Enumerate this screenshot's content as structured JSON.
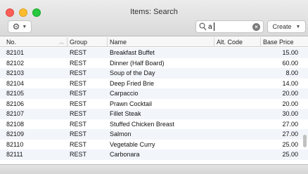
{
  "window": {
    "title": "Items: Search"
  },
  "toolbar": {
    "gear_icon": "gear-icon",
    "search_value": "a",
    "create_label": "Create"
  },
  "columns": {
    "no": "No.",
    "group": "Group",
    "name": "Name",
    "alt_code": "Alt. Code",
    "base_price": "Base Price"
  },
  "rows": [
    {
      "no": "82101",
      "group": "REST",
      "name": "Breakfast Buffet",
      "alt_code": "",
      "price": "15.00"
    },
    {
      "no": "82102",
      "group": "REST",
      "name": "Dinner (Half Board)",
      "alt_code": "",
      "price": "60.00"
    },
    {
      "no": "82103",
      "group": "REST",
      "name": "Soup of the Day",
      "alt_code": "",
      "price": "8.00"
    },
    {
      "no": "82104",
      "group": "REST",
      "name": "Deep Fried Brie",
      "alt_code": "",
      "price": "14.00"
    },
    {
      "no": "82105",
      "group": "REST",
      "name": "Carpaccio",
      "alt_code": "",
      "price": "20.00"
    },
    {
      "no": "82106",
      "group": "REST",
      "name": "Prawn Cocktail",
      "alt_code": "",
      "price": "20.00"
    },
    {
      "no": "82107",
      "group": "REST",
      "name": "Fillet Steak",
      "alt_code": "",
      "price": "30.00"
    },
    {
      "no": "82108",
      "group": "REST",
      "name": "Stuffed Chicken Breast",
      "alt_code": "",
      "price": "27.00"
    },
    {
      "no": "82109",
      "group": "REST",
      "name": "Salmon",
      "alt_code": "",
      "price": "27.00"
    },
    {
      "no": "82110",
      "group": "REST",
      "name": "Vegetable Curry",
      "alt_code": "",
      "price": "25.00"
    },
    {
      "no": "82111",
      "group": "REST",
      "name": "Carbonara",
      "alt_code": "",
      "price": "25.00"
    }
  ]
}
